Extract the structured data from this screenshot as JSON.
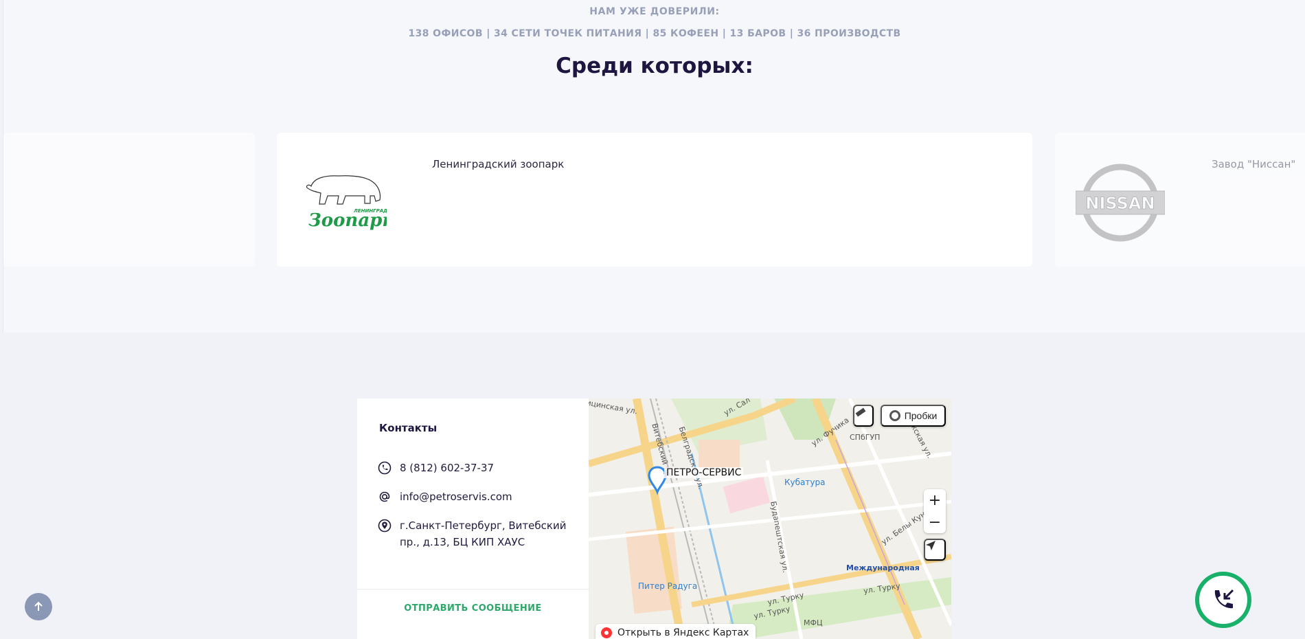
{
  "trusted": {
    "title": "НАМ УЖЕ ДОВЕРИЛИ:",
    "stats": "138 ОФИСОВ | 34 СЕТИ ТОЧЕК ПИТАНИЯ | 85 КОФЕЕН | 13 БАРОВ | 36 ПРОИЗВОДСТВ"
  },
  "among": {
    "title": "Среди которых:"
  },
  "carousel": {
    "center": {
      "label": "Ленинградский зоопарк",
      "logo_text_small": "ЛЕНИНГРАДСКИЙ",
      "logo_text": "Зоопарк"
    },
    "right": {
      "label": "Завод \"Ниссан\"",
      "logo_text": "NISSAN"
    }
  },
  "contacts": {
    "title": "Контакты",
    "phone": "8 (812) 602-37-37",
    "email": "info@petroservis.com",
    "address": "г.Санкт-Петербург, Витебский пр., д.13, БЦ КИП ХАУС",
    "send_label": "ОТПРАВИТЬ СООБЩЕНИЕ"
  },
  "map": {
    "company": "ПЕТРО-СЕРВИС",
    "traffic_label": "Пробки",
    "open_label": "Открыть в Яндекс Картах",
    "poi": {
      "kubatura": "Кубатура",
      "piter_raduga": "Питер Радуга",
      "metro": "Международная",
      "spbgup": "СПбГУП",
      "mfc": "МФЦ"
    },
    "streets": {
      "vitebsky": "Витебский пр.",
      "belgradskaya": "Белградская ул.",
      "fuchika": "ул. Фучика",
      "bela_kuna": "ул. Белы Куна",
      "turku1": "ул. Турку",
      "turku2": "ул. Турку",
      "turku3": "ул. Турку",
      "budapeshtskaya": "Будапештская ул.",
      "prazhskaya": "Пражская ул.",
      "shchinskaya": "ицинская ул.",
      "sal": "ул. Сал"
    }
  },
  "colors": {
    "accent_green": "#19b06a",
    "link_green": "#2ea86a",
    "heading": "#1e1640",
    "muted": "#98a0b8"
  }
}
